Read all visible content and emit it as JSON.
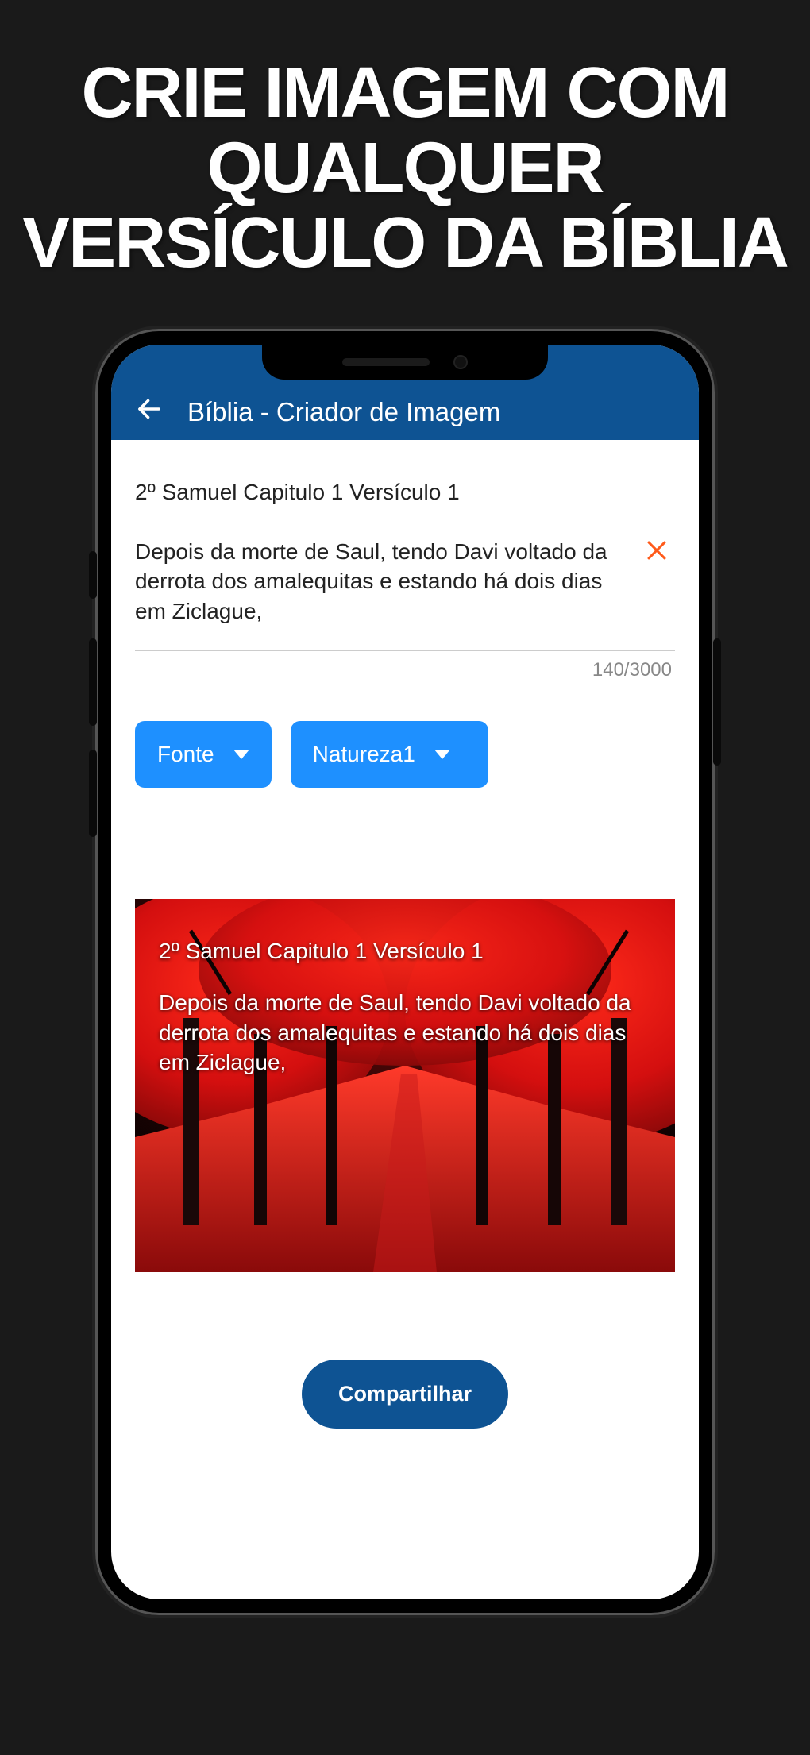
{
  "promo": {
    "title": "CRIE IMAGEM COM QUALQUER VERSÍCULO DA BÍBLIA"
  },
  "appbar": {
    "title": "Bíblia - Criador de Imagem"
  },
  "editor": {
    "verse_ref": "2º Samuel Capitulo 1 Versículo 1",
    "verse_text": "Depois da morte de Saul, tendo Davi voltado da derrota dos amalequitas e estando há dois dias em Ziclague,",
    "counter": "140/3000"
  },
  "dropdowns": {
    "font_label": "Fonte",
    "bg_label": "Natureza1"
  },
  "preview": {
    "verse_ref": "2º Samuel Capitulo 1 Versículo 1",
    "verse_text": "Depois da morte de Saul, tendo Davi voltado da derrota dos amalequitas e estando há dois dias em Ziclague,"
  },
  "buttons": {
    "share": "Compartilhar"
  }
}
